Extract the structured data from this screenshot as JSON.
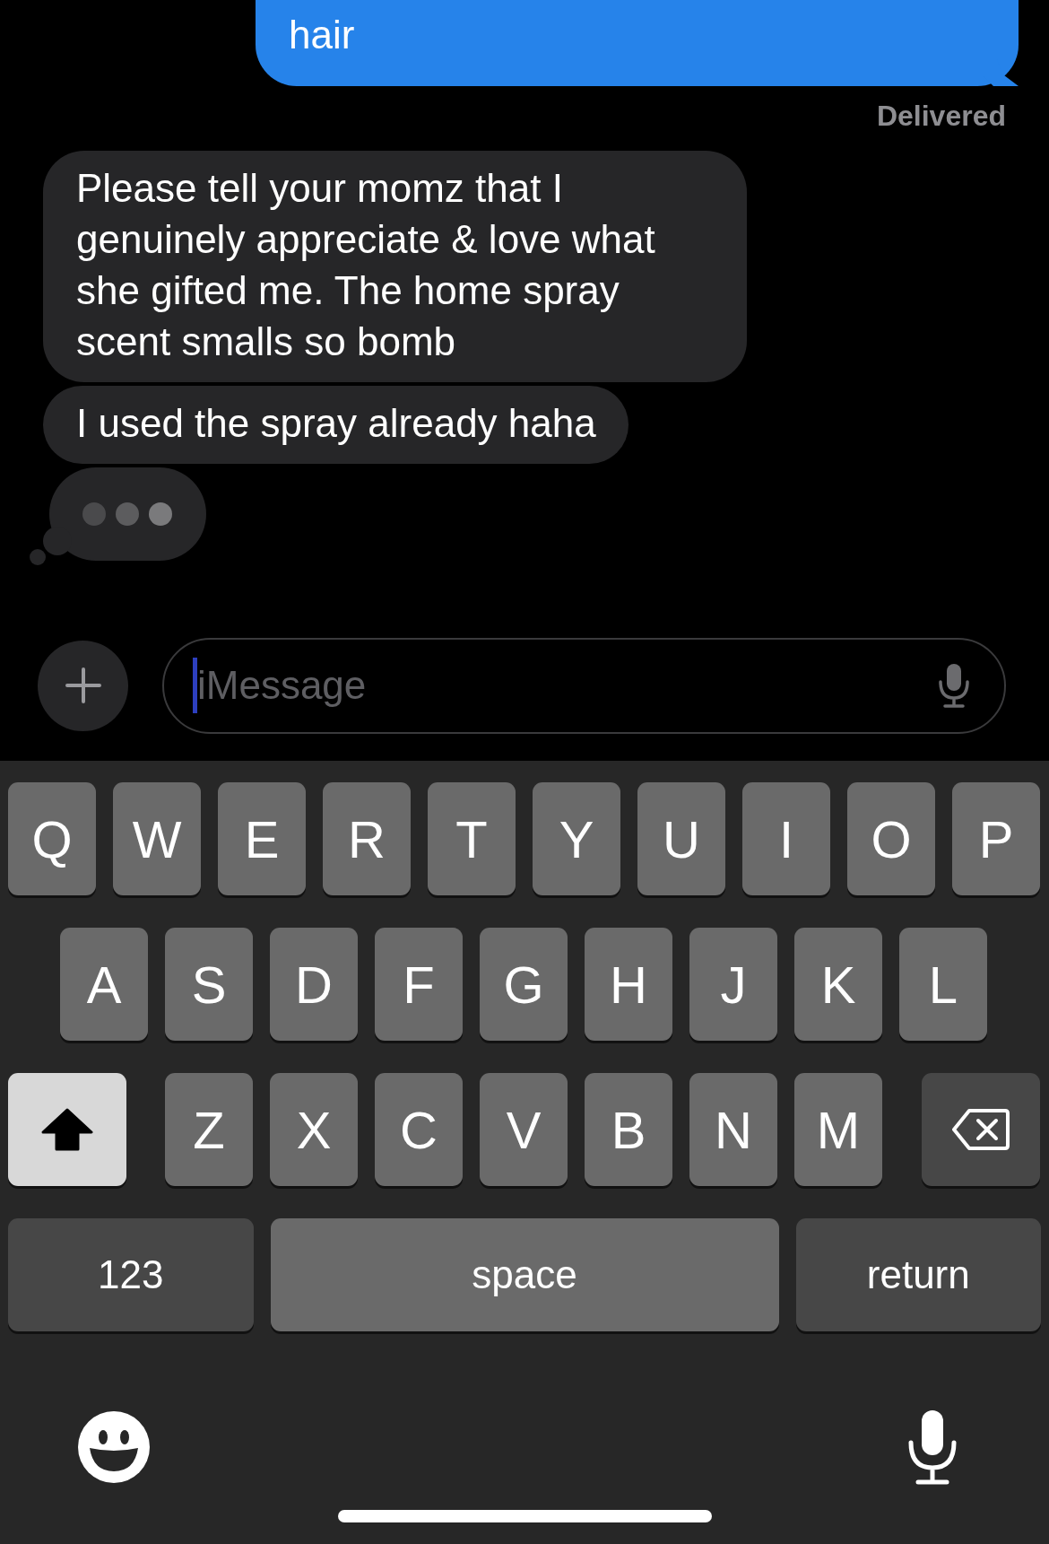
{
  "messages": [
    {
      "kind": "sent",
      "text": "hair"
    },
    {
      "kind": "status",
      "text": "Delivered"
    },
    {
      "kind": "received",
      "text": "Please tell your momz that I genuinely appreciate & love what she gifted me. The home spray scent smalls so bomb"
    },
    {
      "kind": "received",
      "text": "I used the spray already haha"
    },
    {
      "kind": "typing"
    }
  ],
  "composer": {
    "placeholder": "iMessage"
  },
  "keyboard": {
    "rows": [
      {
        "keys": [
          {
            "kind": "letter",
            "label": "Q"
          },
          {
            "kind": "letter",
            "label": "W"
          },
          {
            "kind": "letter",
            "label": "E"
          },
          {
            "kind": "letter",
            "label": "R"
          },
          {
            "kind": "letter",
            "label": "T"
          },
          {
            "kind": "letter",
            "label": "Y"
          },
          {
            "kind": "letter",
            "label": "U"
          },
          {
            "kind": "letter",
            "label": "I"
          },
          {
            "kind": "letter",
            "label": "O"
          },
          {
            "kind": "letter",
            "label": "P"
          }
        ]
      },
      {
        "keys": [
          {
            "kind": "letter",
            "label": "A"
          },
          {
            "kind": "letter",
            "label": "S"
          },
          {
            "kind": "letter",
            "label": "D"
          },
          {
            "kind": "letter",
            "label": "F"
          },
          {
            "kind": "letter",
            "label": "G"
          },
          {
            "kind": "letter",
            "label": "H"
          },
          {
            "kind": "letter",
            "label": "J"
          },
          {
            "kind": "letter",
            "label": "K"
          },
          {
            "kind": "letter",
            "label": "L"
          }
        ]
      },
      {
        "keys": [
          {
            "kind": "shift",
            "on": true
          },
          {
            "kind": "letter",
            "label": "Z"
          },
          {
            "kind": "letter",
            "label": "X"
          },
          {
            "kind": "letter",
            "label": "C"
          },
          {
            "kind": "letter",
            "label": "V"
          },
          {
            "kind": "letter",
            "label": "B"
          },
          {
            "kind": "letter",
            "label": "N"
          },
          {
            "kind": "letter",
            "label": "M"
          },
          {
            "kind": "delete"
          }
        ]
      },
      {
        "keys": [
          {
            "kind": "numbers",
            "label": "123"
          },
          {
            "kind": "space",
            "label": "space"
          },
          {
            "kind": "return",
            "label": "return"
          }
        ]
      }
    ]
  }
}
